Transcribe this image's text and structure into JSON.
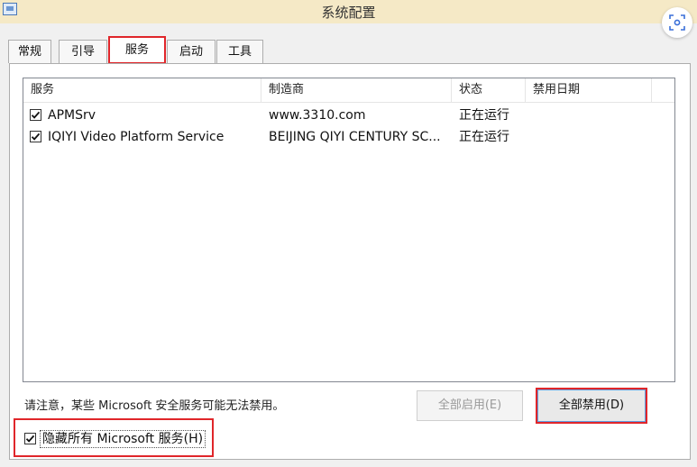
{
  "window": {
    "title": "系统配置"
  },
  "tabs": [
    "常规",
    "引导",
    "服务",
    "启动",
    "工具"
  ],
  "columns": [
    "服务",
    "制造商",
    "状态",
    "禁用日期"
  ],
  "rows": [
    {
      "service": "APMSrv",
      "maker": "www.3310.com",
      "status": "正在运行",
      "date": "",
      "checked": true
    },
    {
      "service": "IQIYI Video Platform Service",
      "maker": "BEIJING QIYI CENTURY SC...",
      "status": "正在运行",
      "date": "",
      "checked": true
    }
  ],
  "note": "请注意，某些 Microsoft 安全服务可能无法禁用。",
  "buttons": {
    "enable_all": "全部启用(E)",
    "disable_all": "全部禁用(D)"
  },
  "hide_ms": {
    "label": "隐藏所有 Microsoft 服务(H)",
    "checked": true
  }
}
